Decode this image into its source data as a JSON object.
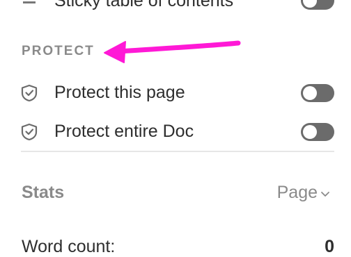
{
  "toc_row": {
    "label": "Sticky table of contents",
    "toggle_on": false,
    "icon": "toc-list-icon"
  },
  "protect_section": {
    "header": "PROTECT",
    "items": [
      {
        "label": "Protect this page",
        "toggle_on": false,
        "icon": "shield-check-icon"
      },
      {
        "label": "Protect entire Doc",
        "toggle_on": false,
        "icon": "shield-check-icon"
      }
    ]
  },
  "stats": {
    "title": "Stats",
    "scope": "Page",
    "word_count_label": "Word count:",
    "word_count_value": "0"
  },
  "annotation": {
    "color": "#ff19d6",
    "icon": "arrow-annotation"
  }
}
